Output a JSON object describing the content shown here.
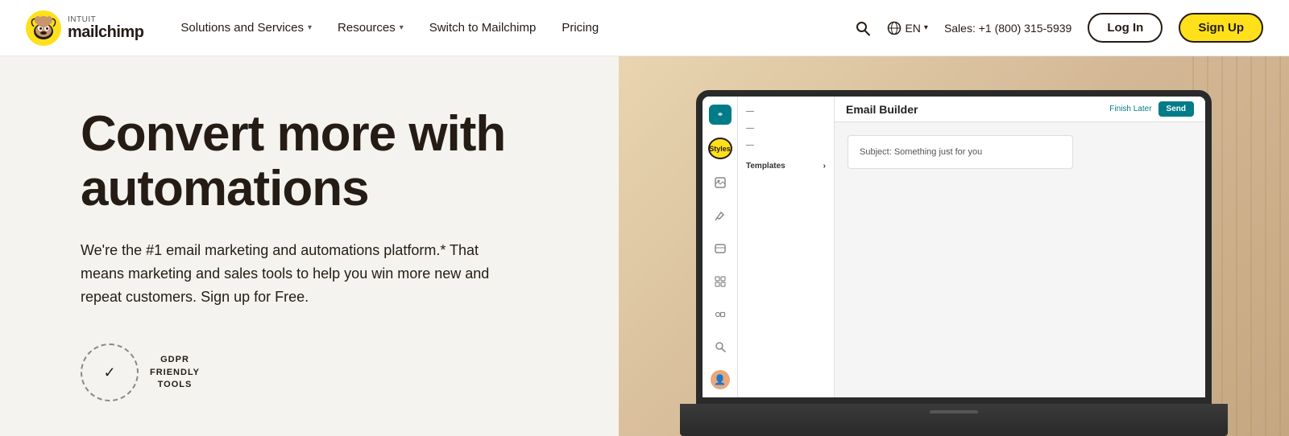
{
  "brand": {
    "intuit_label": "INTUIT",
    "name": "mailchimp"
  },
  "nav": {
    "solutions_label": "Solutions and Services",
    "resources_label": "Resources",
    "switch_label": "Switch to Mailchimp",
    "pricing_label": "Pricing",
    "lang_label": "EN",
    "sales_label": "Sales: +1 (800) 315-5939",
    "login_label": "Log In",
    "signup_label": "Sign Up"
  },
  "hero": {
    "title": "Convert more with automations",
    "description": "We're the #1 email marketing and automations platform.* That means marketing and sales tools to help you win more new and repeat customers. Sign up for Free.",
    "gdpr_line1": "GDPR",
    "gdpr_line2": "FRIENDLY",
    "gdpr_line3": "TOOLS"
  },
  "email_builder": {
    "title": "Email Builder",
    "preview_label": "Finish Later",
    "send_label": "Send",
    "styles_label": "Styles",
    "templates_label": "Templates",
    "subject_label": "Subject:",
    "subject_value": "Something just for you"
  }
}
